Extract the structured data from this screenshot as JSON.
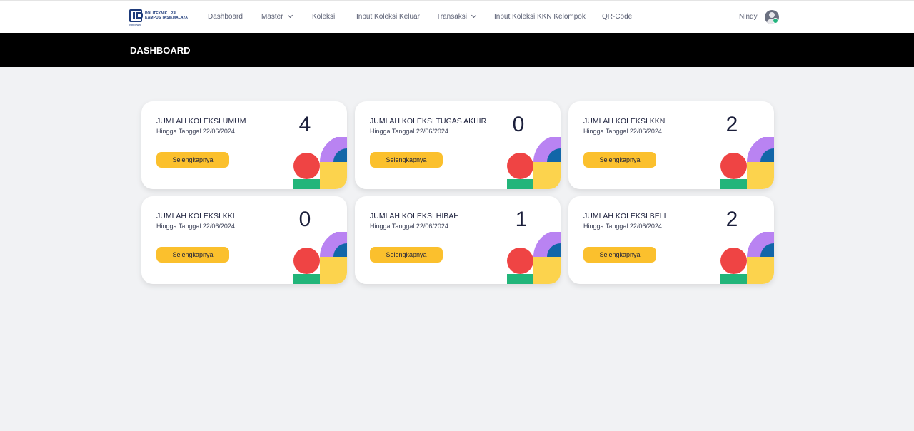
{
  "app": {
    "logo_text_line1": "POLITEKNIK LP3I",
    "logo_text_line2": "KAMPUS TASIKMALAYA",
    "logo_script": "Istimewa"
  },
  "nav": {
    "items": [
      {
        "label": "Dashboard",
        "has_dropdown": false
      },
      {
        "label": "Master",
        "has_dropdown": true
      },
      {
        "label": "Koleksi",
        "has_dropdown": false
      },
      {
        "label": "Input Koleksi Keluar",
        "has_dropdown": false
      },
      {
        "label": "Transaksi",
        "has_dropdown": true
      },
      {
        "label": "Input Koleksi KKN Kelompok",
        "has_dropdown": false
      },
      {
        "label": "QR-Code",
        "has_dropdown": false
      }
    ],
    "user_name": "Nindy",
    "avatar_icon": "user-avatar-icon"
  },
  "page": {
    "title": "DASHBOARD"
  },
  "colors": {
    "header_bg": "#000000",
    "button": "#fbc02d",
    "deco_red": "#ef4444",
    "deco_green": "#22b57a",
    "deco_yellow": "#fcd34d",
    "deco_purple": "#b983f2",
    "deco_blue": "#1266a8",
    "status_online": "#24b47e"
  },
  "cards": [
    {
      "title": "JUMLAH KOLEKSI UMUM",
      "date_prefix": "Hingga Tanggal ",
      "date": "22/06/2024",
      "count": "4",
      "button": "Selengkapnya"
    },
    {
      "title": "JUMLAH KOLEKSI TUGAS AKHIR",
      "date_prefix": "Hingga Tanggal ",
      "date": "22/06/2024",
      "count": "0",
      "button": "Selengkapnya"
    },
    {
      "title": "JUMLAH KOLEKSI KKN",
      "date_prefix": "Hingga Tanggal ",
      "date": "22/06/2024",
      "count": "2",
      "button": "Selengkapnya"
    },
    {
      "title": "JUMLAH KOLEKSI KKI",
      "date_prefix": "Hingga Tanggal ",
      "date": "22/06/2024",
      "count": "0",
      "button": "Selengkapnya"
    },
    {
      "title": "JUMLAH KOLEKSI HIBAH",
      "date_prefix": "Hingga Tanggal ",
      "date": "22/06/2024",
      "count": "1",
      "button": "Selengkapnya"
    },
    {
      "title": "JUMLAH KOLEKSI BELI",
      "date_prefix": "Hingga Tanggal ",
      "date": "22/06/2024",
      "count": "2",
      "button": "Selengkapnya"
    }
  ]
}
